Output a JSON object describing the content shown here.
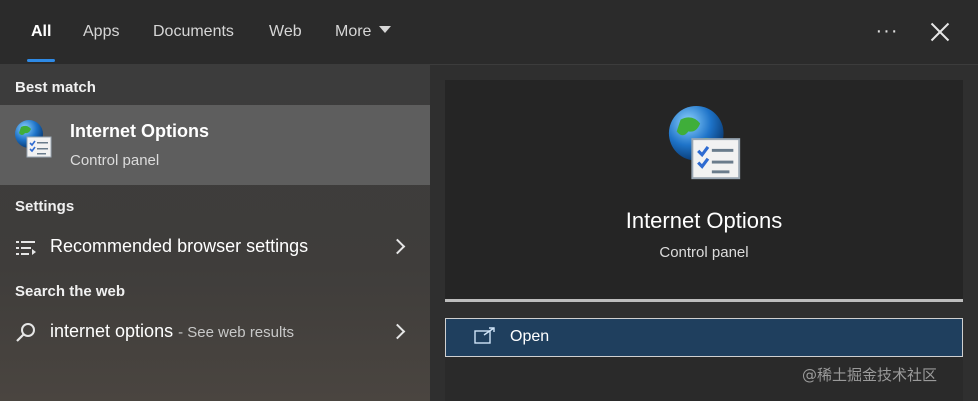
{
  "tabs": [
    {
      "label": "All",
      "active": true
    },
    {
      "label": "Apps",
      "active": false
    },
    {
      "label": "Documents",
      "active": false
    },
    {
      "label": "Web",
      "active": false
    },
    {
      "label": "More",
      "active": false
    }
  ],
  "header": {
    "more_icon": "ellipsis-icon",
    "close_icon": "close-icon"
  },
  "sections": {
    "best_match": "Best match",
    "settings": "Settings",
    "search_web": "Search the web"
  },
  "best_match": {
    "title": "Internet Options",
    "subtitle": "Control panel",
    "icon": "internet-options-icon"
  },
  "settings_items": [
    {
      "label": "Recommended browser settings",
      "icon": "settings-list-icon"
    }
  ],
  "web_search": {
    "query": "internet options",
    "suffix": "- See web results",
    "icon": "search-icon"
  },
  "preview": {
    "title": "Internet Options",
    "subtitle": "Control panel",
    "icon": "internet-options-icon"
  },
  "actions": [
    {
      "label": "Open",
      "icon": "open-icon"
    }
  ],
  "watermark": "@稀土掘金技术社区",
  "colors": {
    "accent": "#2e8ae6",
    "selected_row": "#5e5e5e",
    "open_button": "#1f3f5e"
  }
}
